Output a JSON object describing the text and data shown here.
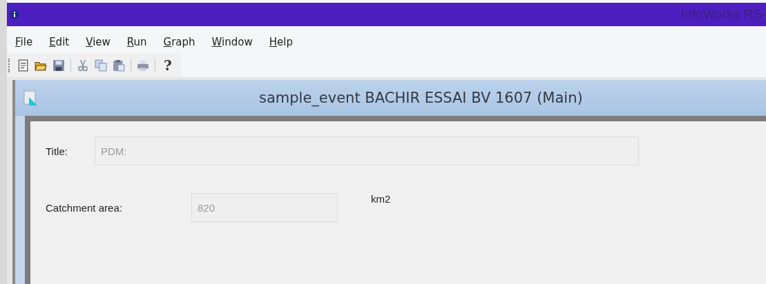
{
  "window": {
    "title": "InfoWorks RS-"
  },
  "menu": [
    "File",
    "Edit",
    "View",
    "Run",
    "Graph",
    "Window",
    "Help"
  ],
  "toolbar": [
    {
      "kind": "new"
    },
    {
      "kind": "open"
    },
    {
      "kind": "save"
    },
    {
      "kind": "separator"
    },
    {
      "kind": "cut"
    },
    {
      "kind": "copy"
    },
    {
      "kind": "paste"
    },
    {
      "kind": "separator"
    },
    {
      "kind": "print"
    },
    {
      "kind": "separator"
    },
    {
      "kind": "help",
      "label": "?"
    }
  ],
  "child_window": {
    "title": "sample_event BACHIR ESSAI BV 1607 (Main)",
    "fields": [
      {
        "label": "Title:",
        "value": "PDM:",
        "disabled": true,
        "kind": "wide"
      },
      {
        "label": "Catchment area:",
        "value": "820",
        "disabled": true,
        "kind": "short",
        "unit": "km2"
      }
    ]
  }
}
